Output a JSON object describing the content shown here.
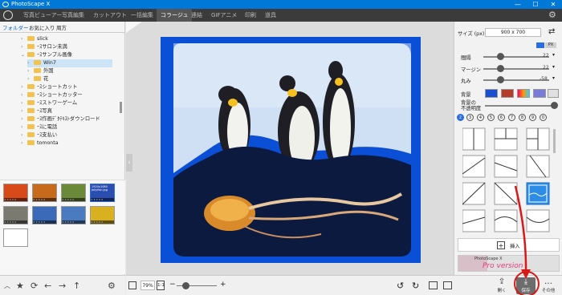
{
  "app": {
    "title": "PhotoScape X"
  },
  "menu": {
    "tabs": [
      "写真ビューアー",
      "写真編集",
      "カットアウト",
      "一括編集",
      "コラージュ",
      "連結",
      "GIFアニメ",
      "印刷",
      "道具"
    ],
    "active_tab": "コラージュ"
  },
  "folder_tabs": {
    "folders": "フォルダー",
    "favorites": "お気に入り",
    "recent": "周方"
  },
  "tree": [
    {
      "label": "slick",
      "open": false,
      "depth": 1
    },
    {
      "label": "ｰｽサロン未満",
      "open": false,
      "depth": 1
    },
    {
      "label": "ｰｽサンプル画像",
      "open": true,
      "depth": 1
    },
    {
      "label": "Win7",
      "open": false,
      "depth": 2,
      "selected": true
    },
    {
      "label": "外国",
      "open": false,
      "depth": 2
    },
    {
      "label": "花",
      "open": false,
      "depth": 2
    },
    {
      "label": "ｰｽショートカット",
      "open": false,
      "depth": 1
    },
    {
      "label": "ｰｽショートカッター",
      "open": false,
      "depth": 1
    },
    {
      "label": "ｰｽストワーゲーム",
      "open": false,
      "depth": 1
    },
    {
      "label": "ｰｽ写真",
      "open": false,
      "depth": 1
    },
    {
      "label": "ｰｽ作画ﾃﾞﾀﾃｷｽﾄダウンロード",
      "open": false,
      "depth": 1
    },
    {
      "label": "ｰｽに電話",
      "open": false,
      "depth": 1
    },
    {
      "label": "ｰｽ支払い",
      "open": false,
      "depth": 1
    },
    {
      "label": "tomonta",
      "open": false,
      "depth": 1
    }
  ],
  "thumbnails": [
    {
      "name": "flowers-red",
      "color": "#d94a1a"
    },
    {
      "name": "sunset",
      "color": "#c76a1c"
    },
    {
      "name": "flower-white",
      "color": "#6a8a3a"
    },
    {
      "name": "selected-image",
      "color": "#2a4db0",
      "caption": "1920x1080 Jellyfish.jpg"
    },
    {
      "name": "koala",
      "color": "#7a7a70"
    },
    {
      "name": "lighthouse",
      "color": "#3a6ab8"
    },
    {
      "name": "penguins",
      "color": "#4a7ac0"
    },
    {
      "name": "tulips",
      "color": "#d8b020"
    },
    {
      "name": "blank",
      "color": "#ffffff"
    }
  ],
  "zoom": {
    "value": "79%",
    "ratio": "1:1"
  },
  "right": {
    "size_label": "サイズ (px)",
    "size_value": "900 x 700",
    "badge": "PX",
    "spacing_label": "間隔",
    "spacing_value": "22",
    "margin_label": "マージン",
    "margin_value": "22",
    "round_label": "丸み",
    "round_value": "-58",
    "bg_label": "背景",
    "bg_opacity_label": "背景の\n不透明度",
    "numbers": [
      "2",
      "3",
      "4",
      "5",
      "6",
      "7",
      "8",
      "9",
      "0"
    ],
    "insert_label": "挿入",
    "promo_title": "PhotoScape X",
    "promo_text": "Pro version"
  },
  "bottom_right": {
    "open_label": "開く",
    "save_label": "保存",
    "more_label": "その他"
  },
  "colors": {
    "accent": "#0078d7",
    "collage_border": "#0a4fd6",
    "highlight_red": "#d61a1a"
  }
}
